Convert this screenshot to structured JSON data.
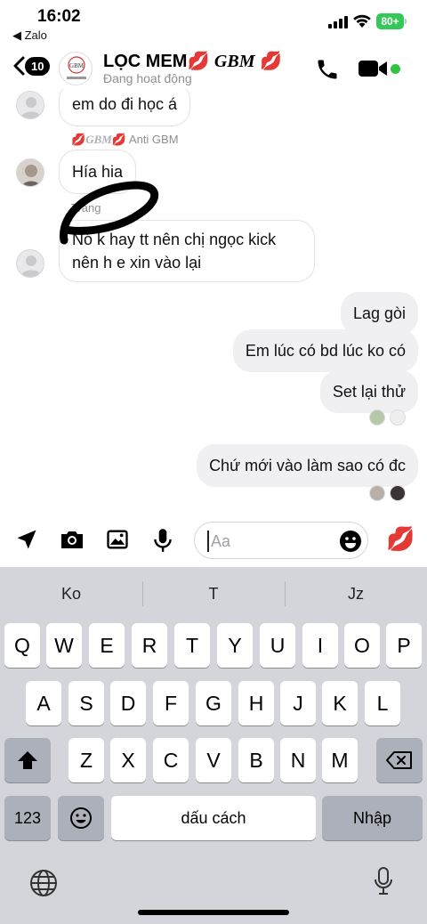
{
  "status": {
    "time": "16:02",
    "back_app": "◀ Zalo",
    "battery": "80+"
  },
  "header": {
    "badge": "10",
    "title_main": "LỌC MEM",
    "title_lips1": "💋",
    "title_gbm": "GBM",
    "title_lips2": "💋",
    "subtitle": "Đang hoạt động",
    "avatar_text": "GBM"
  },
  "messages": {
    "m1": "em do đi học á",
    "sender2_lips1": "💋",
    "sender2_gbm": "GBM",
    "sender2_lips2": "💋",
    "sender2_name": "Anti GBM",
    "m2": "Hía hia",
    "sender3_name": "Trang",
    "m3_line1": "Nó k hay tt nên chị ngọc kick",
    "m3_line2": "nên h e xin vào lại",
    "m4": "Lag gòi",
    "m5": "Em lúc có bd lúc ko có",
    "m6": "Set lại thử",
    "m7": "Chứ mới vào làm sao có đc"
  },
  "composer": {
    "placeholder": "Aa",
    "like_emoji": "💋"
  },
  "keyboard": {
    "suggestions": [
      "Ko",
      "T",
      "Jz"
    ],
    "row1": [
      "Q",
      "W",
      "E",
      "R",
      "T",
      "Y",
      "U",
      "I",
      "O",
      "P"
    ],
    "row2": [
      "A",
      "S",
      "D",
      "F",
      "G",
      "H",
      "J",
      "K",
      "L"
    ],
    "row3": [
      "Z",
      "X",
      "C",
      "V",
      "B",
      "N",
      "M"
    ],
    "numbers": "123",
    "space": "dấu cách",
    "enter": "Nhập"
  },
  "colors": {
    "online": "#31c53f",
    "battery": "#34c759",
    "keyboard_bg": "#d3d5db"
  }
}
